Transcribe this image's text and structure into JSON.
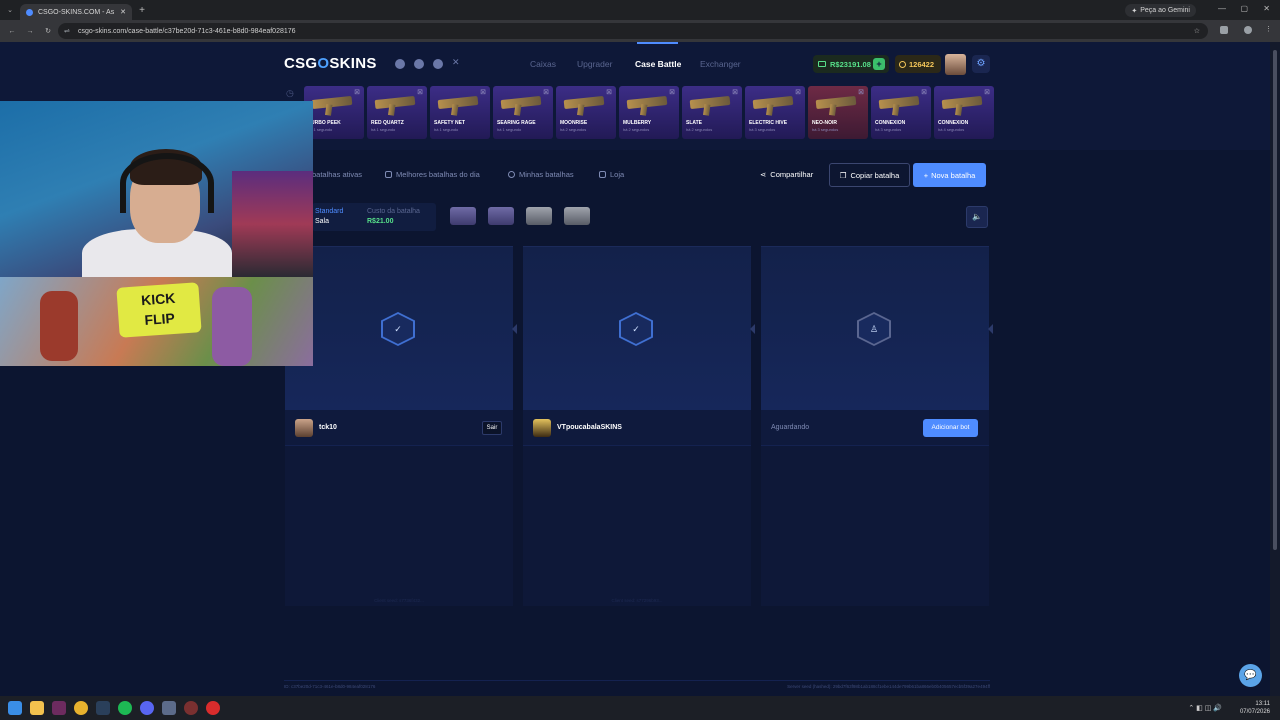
{
  "browser": {
    "tab_title": "CSGO-SKINS.COM - As melhore",
    "gemini": "Peça ao Gemini",
    "url": "csgo-skins.com/case-battle/c37be20d-71c3-461e-b8d0-984eaf028176"
  },
  "site": {
    "logo_left": "CSG",
    "logo_o": "O",
    "logo_right": "SKINS",
    "nav": [
      "Caixas",
      "Upgrader",
      "Case Battle",
      "Exchanger"
    ],
    "balance": "R$23191.08",
    "coins": "126422"
  },
  "drops": [
    {
      "name": "TURBO PEEK",
      "sub": "há 1 segundo",
      "color": "#3c2d86"
    },
    {
      "name": "RED QUARTZ",
      "sub": "há 1 segundo",
      "color": "#3c2d86"
    },
    {
      "name": "SAFETY NET",
      "sub": "há 1 segundo",
      "color": "#3c2d86"
    },
    {
      "name": "SEARING RAGE",
      "sub": "há 1 segundo",
      "color": "#3c2d86"
    },
    {
      "name": "MOONRISE",
      "sub": "há 2 segundos",
      "color": "#3c2d86"
    },
    {
      "name": "MULBERRY",
      "sub": "há 2 segundos",
      "color": "#3c2d86"
    },
    {
      "name": "SLATE",
      "sub": "há 2 segundos",
      "color": "#3c2d86"
    },
    {
      "name": "ELECTRIC HIVE",
      "sub": "há 3 segundos",
      "color": "#3c2d86"
    },
    {
      "name": "NEO-NOIR",
      "sub": "há 3 segundos",
      "color": "#6e2a45"
    },
    {
      "name": "CONNEXION",
      "sub": "há 3 segundos",
      "color": "#3c2d86"
    },
    {
      "name": "CONNEXION",
      "sub": "há 4 segundos",
      "color": "#3c2d86"
    }
  ],
  "toolbar": {
    "active": "batalhas ativas",
    "best": "Melhores batalhas do dia",
    "mine": "Minhas batalhas",
    "shop": "Loja",
    "share": "Compartilhar",
    "copy": "Copiar batalha",
    "new": "Nova batalha"
  },
  "battle": {
    "mode_label": "Standard",
    "mode_value": "Sala",
    "cost_label": "Custo da batalha",
    "cost_value": "R$21.00"
  },
  "slots": [
    {
      "player": "tck10",
      "leave": "Sair",
      "seed": "Client seed: s7736f432..."
    },
    {
      "player": "VTpoucabalaSKINS",
      "seed": "Client seed: s77296b93..."
    },
    {
      "waiting": "Aguardando",
      "add_bot": "Adicionar bot"
    }
  ],
  "footer": {
    "id": "ID: c37be20d-71c3-461e-b8d0-984eaf028176",
    "server": "Server seed (hashed): 29bd7f63f98b1ab188cf1ebe144de799b61ba866eb0b405657ecb5f39a27e494ff"
  },
  "clock": {
    "time": "13:11",
    "date": "07/07/2026"
  }
}
